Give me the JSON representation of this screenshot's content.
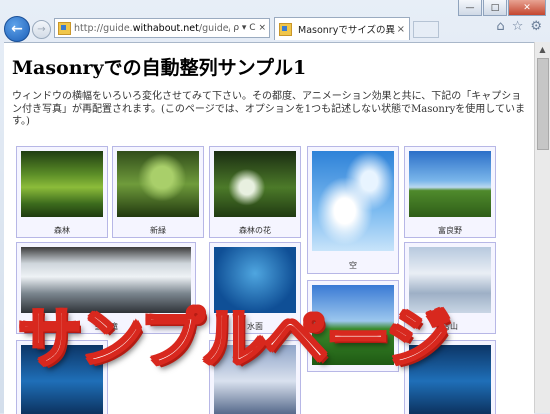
{
  "browser": {
    "url_prefix": "http://guide.",
    "url_domain": "withabout.net",
    "url_path": "/guide/gp332/",
    "address_icons": "ρ ▾ C ×",
    "tab_title": "Masonryでサイズの異な...",
    "tab_close": "×",
    "back_glyph": "←",
    "forward_glyph": "→",
    "window_controls": [
      "—",
      "□",
      "✕"
    ],
    "toolbar_icons": [
      "⌂",
      "☆",
      "⚙"
    ]
  },
  "page": {
    "title": "Masonryでの自動整列サンプル1",
    "intro": "ウィンドウの横幅をいろいろ変化させてみて下さい。その都度、アニメーション効果と共に、下記の「キャプション付き写真」が再配置されます。(このページでは、オプションを1つも記述しない状態でMasonryを使用しています。)",
    "items": [
      {
        "caption": "森林"
      },
      {
        "caption": "新緑"
      },
      {
        "caption": "森林の花"
      },
      {
        "caption": "空"
      },
      {
        "caption": "富良野"
      },
      {
        "caption": "雪の滝"
      },
      {
        "caption": "水面"
      },
      {
        "caption": "雪山"
      }
    ]
  },
  "overlay_text": "サンプルページ"
}
